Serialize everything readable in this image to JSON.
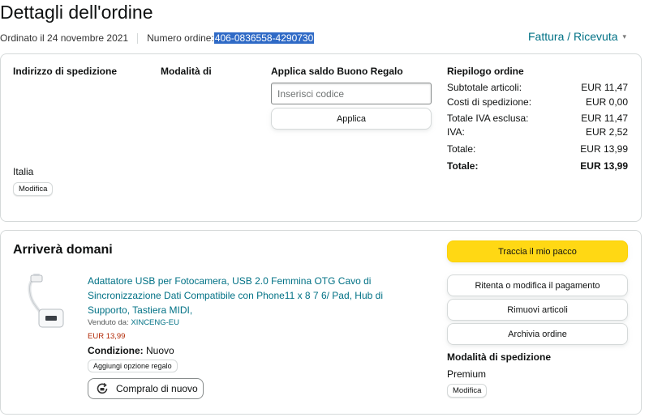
{
  "header": {
    "title": "Dettagli dell'ordine",
    "ordered_on": "Ordinato il 24 novembre 2021",
    "order_number_label": "Numero ordine:",
    "order_number": "406-0836558-4290730",
    "invoice_label": "Fattura / Ricevuta"
  },
  "shipping_address": {
    "heading": "Indirizzo di spedizione",
    "country": "Italia",
    "edit_label": "Modifica"
  },
  "payment": {
    "heading": "Modalità di"
  },
  "gift_card": {
    "heading": "Applica saldo Buono Regalo",
    "placeholder": "Inserisci codice",
    "apply_label": "Applica"
  },
  "summary": {
    "heading": "Riepilogo ordine",
    "rows": [
      {
        "label": "Subtotale articoli:",
        "value": "EUR 11,47"
      },
      {
        "label": "Costi di spedizione:",
        "value": "EUR 0,00"
      },
      {
        "label": "Totale IVA esclusa:",
        "value": "EUR 11,47"
      },
      {
        "label": "IVA:",
        "value": "EUR 2,52"
      },
      {
        "label": "Totale:",
        "value": "EUR 13,99"
      }
    ],
    "grand_total_label": "Totale:",
    "grand_total_value": "EUR 13,99"
  },
  "shipment": {
    "status": "Arriverà domani",
    "product_title": "Adattatore USB per Fotocamera, USB 2.0 Femmina OTG Cavo di Sincronizzazione Dati Compatibile con Phone11 x 8 7 6/ Pad, Hub di Supporto, Tastiera MIDI,",
    "sold_by_label": "Venduto da:",
    "seller": "XINCENG-EU",
    "price": "EUR 13,99",
    "condition_label": "Condizione:",
    "condition_value": "Nuovo",
    "gift_option_label": "Aggiungi opzione regalo",
    "buy_again_label": "Compralo di nuovo",
    "buy_again_icon": "refresh-cart-icon"
  },
  "actions": {
    "track": "Traccia il mio pacco",
    "retry_payment": "Ritenta o modifica il pagamento",
    "remove_items": "Rimuovi articoli",
    "archive": "Archivia ordine",
    "shipping_method_heading": "Modalità di spedizione",
    "shipping_method": "Premium",
    "edit_label": "Modifica"
  },
  "colors": {
    "link": "#007185",
    "price": "#b12704",
    "primary_button": "#ffd814",
    "selection": "#2f6ac6"
  }
}
